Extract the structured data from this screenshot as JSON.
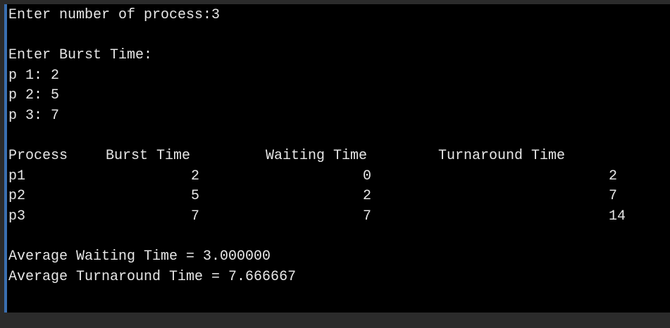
{
  "console": {
    "prompt_processes": "Enter number of process:3",
    "prompt_burst": "Enter Burst Time:",
    "burst_inputs": [
      "p 1: 2",
      "p 2: 5",
      "p 3: 7"
    ],
    "table": {
      "headers": [
        "Process",
        "Burst Time",
        "Waiting Time",
        "Turnaround Time"
      ],
      "rows": [
        {
          "process": "p1",
          "burst": "2",
          "waiting": "0",
          "turnaround": "2"
        },
        {
          "process": "p2",
          "burst": "5",
          "waiting": "2",
          "turnaround": "7"
        },
        {
          "process": "p3",
          "burst": "7",
          "waiting": "7",
          "turnaround": "14"
        }
      ]
    },
    "avg_waiting": "Average Waiting Time = 3.000000",
    "avg_turnaround": "Average Turnaround Time = 7.666667"
  }
}
